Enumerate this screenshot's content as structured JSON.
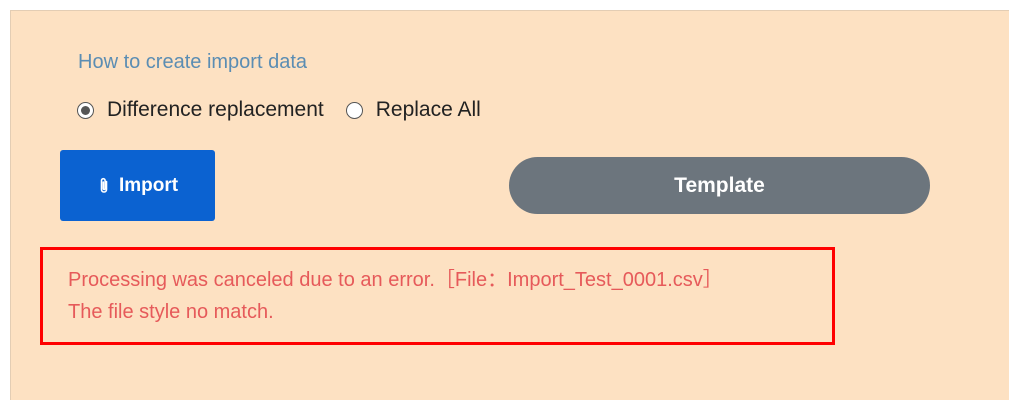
{
  "import_section": {
    "title": "How to create import data",
    "options": [
      {
        "label": "Difference replacement",
        "selected": true
      },
      {
        "label": "Replace All",
        "selected": false
      }
    ]
  },
  "buttons": {
    "import_label": "Import",
    "template_label": "Template"
  },
  "icons": {
    "import_icon": "paperclip-icon"
  },
  "error": {
    "line1": "Processing was canceled due to an error.［File：Import_Test_0001.csv］",
    "line2": "The file style no match."
  },
  "colors": {
    "panel_background": "#fde1c2",
    "title": "#5b8db3",
    "import_button": "#0b62d1",
    "template_button": "#6c757d",
    "error_border": "#ff0000",
    "error_text": "#e65a5a"
  }
}
